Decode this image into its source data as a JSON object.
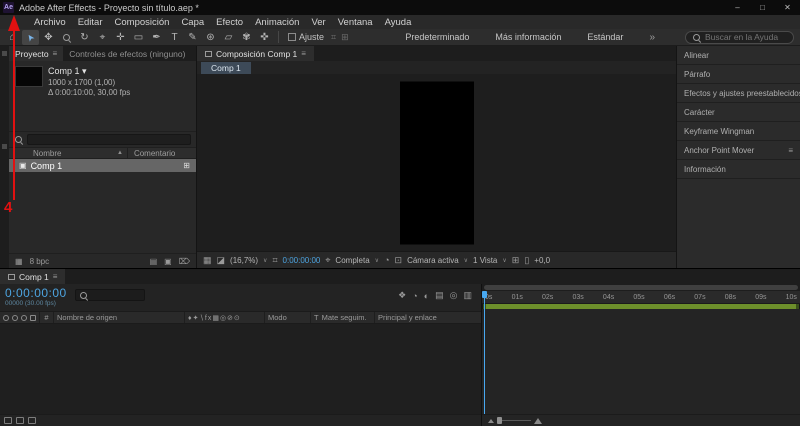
{
  "annotation": {
    "step": "4",
    "color": "#e11111"
  },
  "colors": {
    "time_accent": "#4da4e0",
    "work_area_green": "#6d8f2b",
    "selection_blue": "#7ab4e8"
  },
  "titlebar": {
    "badge": "Ae",
    "title": "Adobe After Effects - Proyecto sin título.aep *",
    "minimize": "–",
    "maximize": "□",
    "close": "✕"
  },
  "menubar": {
    "items": [
      "Archivo",
      "Editar",
      "Composición",
      "Capa",
      "Efecto",
      "Animación",
      "Ver",
      "Ventana",
      "Ayuda"
    ]
  },
  "toolbar": {
    "tools": [
      {
        "name": "home",
        "glyph": "⌂"
      },
      {
        "name": "selection",
        "glyph": "➤"
      },
      {
        "name": "hand",
        "glyph": "✥"
      },
      {
        "name": "zoom"
      },
      {
        "name": "orbit-camera",
        "glyph": "↻"
      },
      {
        "name": "camera",
        "glyph": "⌖"
      },
      {
        "name": "pan-behind",
        "glyph": "✛"
      },
      {
        "name": "shape",
        "glyph": "▭"
      },
      {
        "name": "pen",
        "glyph": "✒"
      },
      {
        "name": "type",
        "glyph": "T"
      },
      {
        "name": "brush",
        "glyph": "✎"
      },
      {
        "name": "clone-stamp",
        "glyph": "⊛"
      },
      {
        "name": "eraser",
        "glyph": "▱"
      },
      {
        "name": "roto-brush",
        "glyph": "✾"
      },
      {
        "name": "puppet-pin",
        "glyph": "✜"
      }
    ],
    "snap_label": "Ajuste",
    "extra_icons": {
      "mask_options": "⌗",
      "blend_options": "⊞"
    },
    "workspaces": [
      "Predeterminado",
      "Más información",
      "Estándar"
    ],
    "overflow": "»",
    "search_placeholder": "Buscar en la Ayuda"
  },
  "project": {
    "tab_active": "Proyecto",
    "tab_inactive": "Controles de efectos (ninguno)",
    "panel_menu": "≡",
    "preview": {
      "name": "Comp 1",
      "caret": "▾",
      "size": "1000 x 1700 (1,00)",
      "duration": "Δ 0:00:10:00, 30,00 fps"
    },
    "columns": {
      "name": "Nombre",
      "sort": "▲",
      "comment": "Comentario"
    },
    "rows": [
      {
        "name": "Comp 1",
        "icon": "▣",
        "right_icon": "⊞"
      }
    ],
    "footer": {
      "depth": "8 bpc",
      "icons": {
        "interpret": "▦",
        "new_folder": "▤",
        "new_comp": "▣",
        "delete": "⌦"
      }
    }
  },
  "composition": {
    "panel_tab": "Composición Comp 1",
    "panel_menu": "≡",
    "viewer_tab": "Comp 1",
    "footer": {
      "zoom": "(16,7%)",
      "caret": "∨",
      "time": "0:00:00:00",
      "resolution": "Completa",
      "camera": "Cámara activa",
      "view": "1 Vista",
      "exposure": "+0,0",
      "icons": {
        "grid": "▦",
        "snapshot": "◪",
        "ruler": "⌗",
        "camera": "⌖",
        "fast_previews": "◔",
        "roi": "⊡",
        "guides": "⊞",
        "pixel_aspect": "▯"
      }
    }
  },
  "right_panels": {
    "items": [
      {
        "label": "Alinear"
      },
      {
        "label": "Párrafo"
      },
      {
        "label": "Efectos y ajustes preestablecidos"
      },
      {
        "label": "Carácter"
      },
      {
        "label": "Keyframe Wingman"
      },
      {
        "label": "Anchor Point Mover",
        "menu": "≡"
      },
      {
        "label": "Información"
      }
    ]
  },
  "timeline": {
    "tab": "Comp 1",
    "panel_menu": "≡",
    "time": "0:00:00:00",
    "time_detail": "00000 (30.00 fps)",
    "icons": {
      "flowchart": "❖",
      "draft": "◔",
      "hide_shy": "◐",
      "frame_blend": "▤",
      "motion_blur": "◎",
      "graph": "▥"
    },
    "headers": {
      "number": "#",
      "source_name": "Nombre de origen",
      "switches": "♦✦∖fx▦◎⊘⊙",
      "mode": "Modo",
      "t": "T",
      "matte": "Mate seguim.",
      "parent": "Principal y enlace"
    },
    "ruler": [
      "0s",
      "01s",
      "02s",
      "03s",
      "04s",
      "05s",
      "06s",
      "07s",
      "08s",
      "09s",
      "10s"
    ]
  }
}
